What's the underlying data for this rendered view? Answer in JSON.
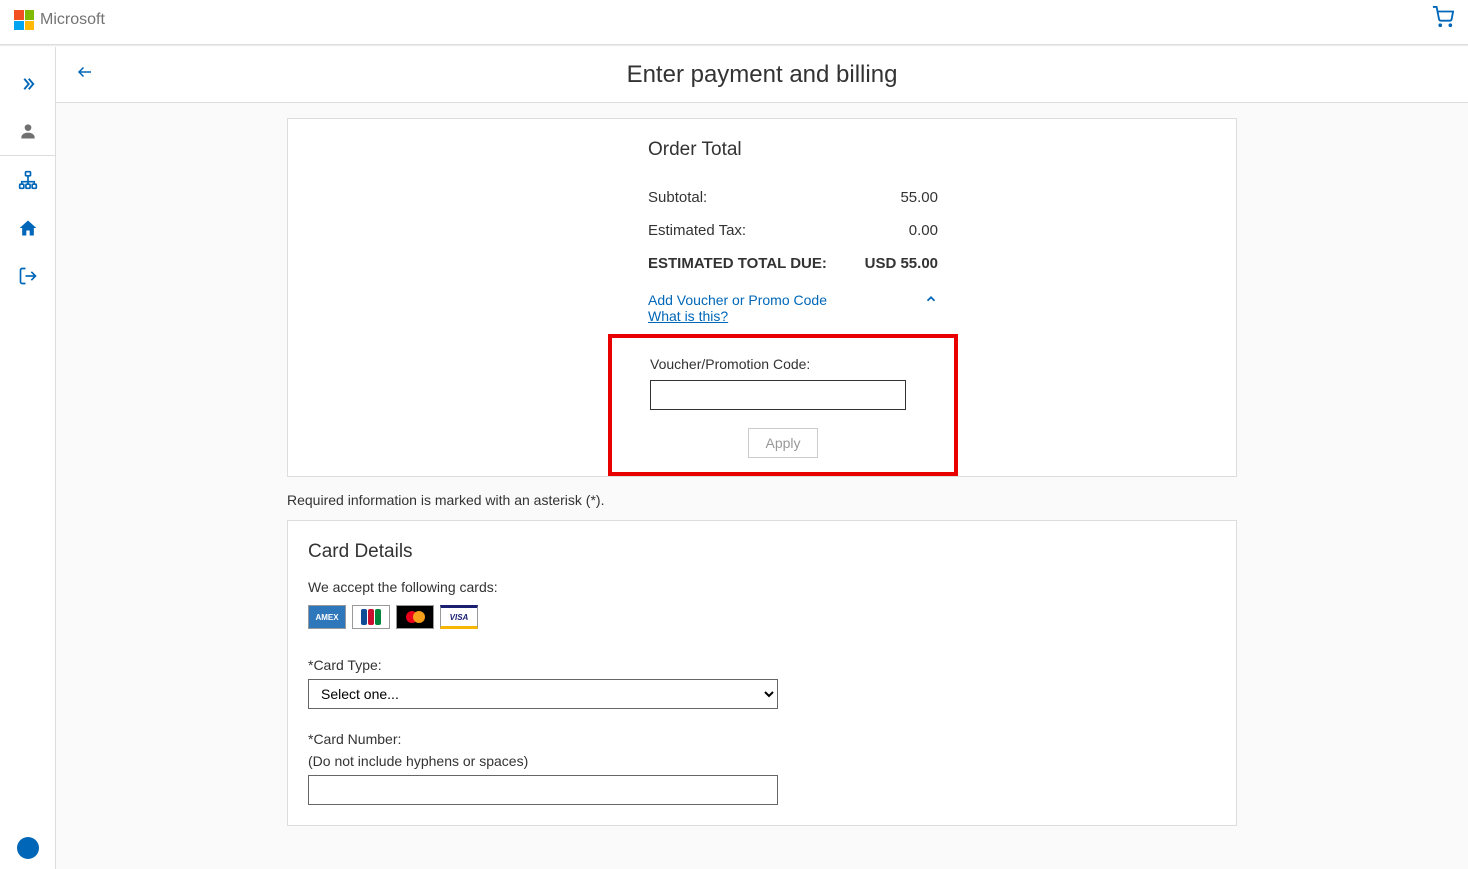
{
  "header": {
    "brand": "Microsoft"
  },
  "page": {
    "title": "Enter payment and billing"
  },
  "order": {
    "title": "Order Total",
    "subtotal_label": "Subtotal:",
    "subtotal_value": "55.00",
    "tax_label": "Estimated Tax:",
    "tax_value": "0.00",
    "total_label": "ESTIMATED TOTAL DUE:",
    "total_value": "USD 55.00",
    "voucher_link": "Add Voucher or Promo Code",
    "what_is_this": "What is this?"
  },
  "voucher": {
    "label": "Voucher/Promotion Code:",
    "apply": "Apply"
  },
  "required_note": "Required information is marked with an asterisk (*).",
  "card_details": {
    "title": "Card Details",
    "accept_text": "We accept the following cards:",
    "card_type_label": "*Card Type:",
    "card_type_placeholder": "Select one...",
    "card_number_label": "*Card Number:",
    "card_number_hint": "(Do not include hyphens or spaces)"
  }
}
